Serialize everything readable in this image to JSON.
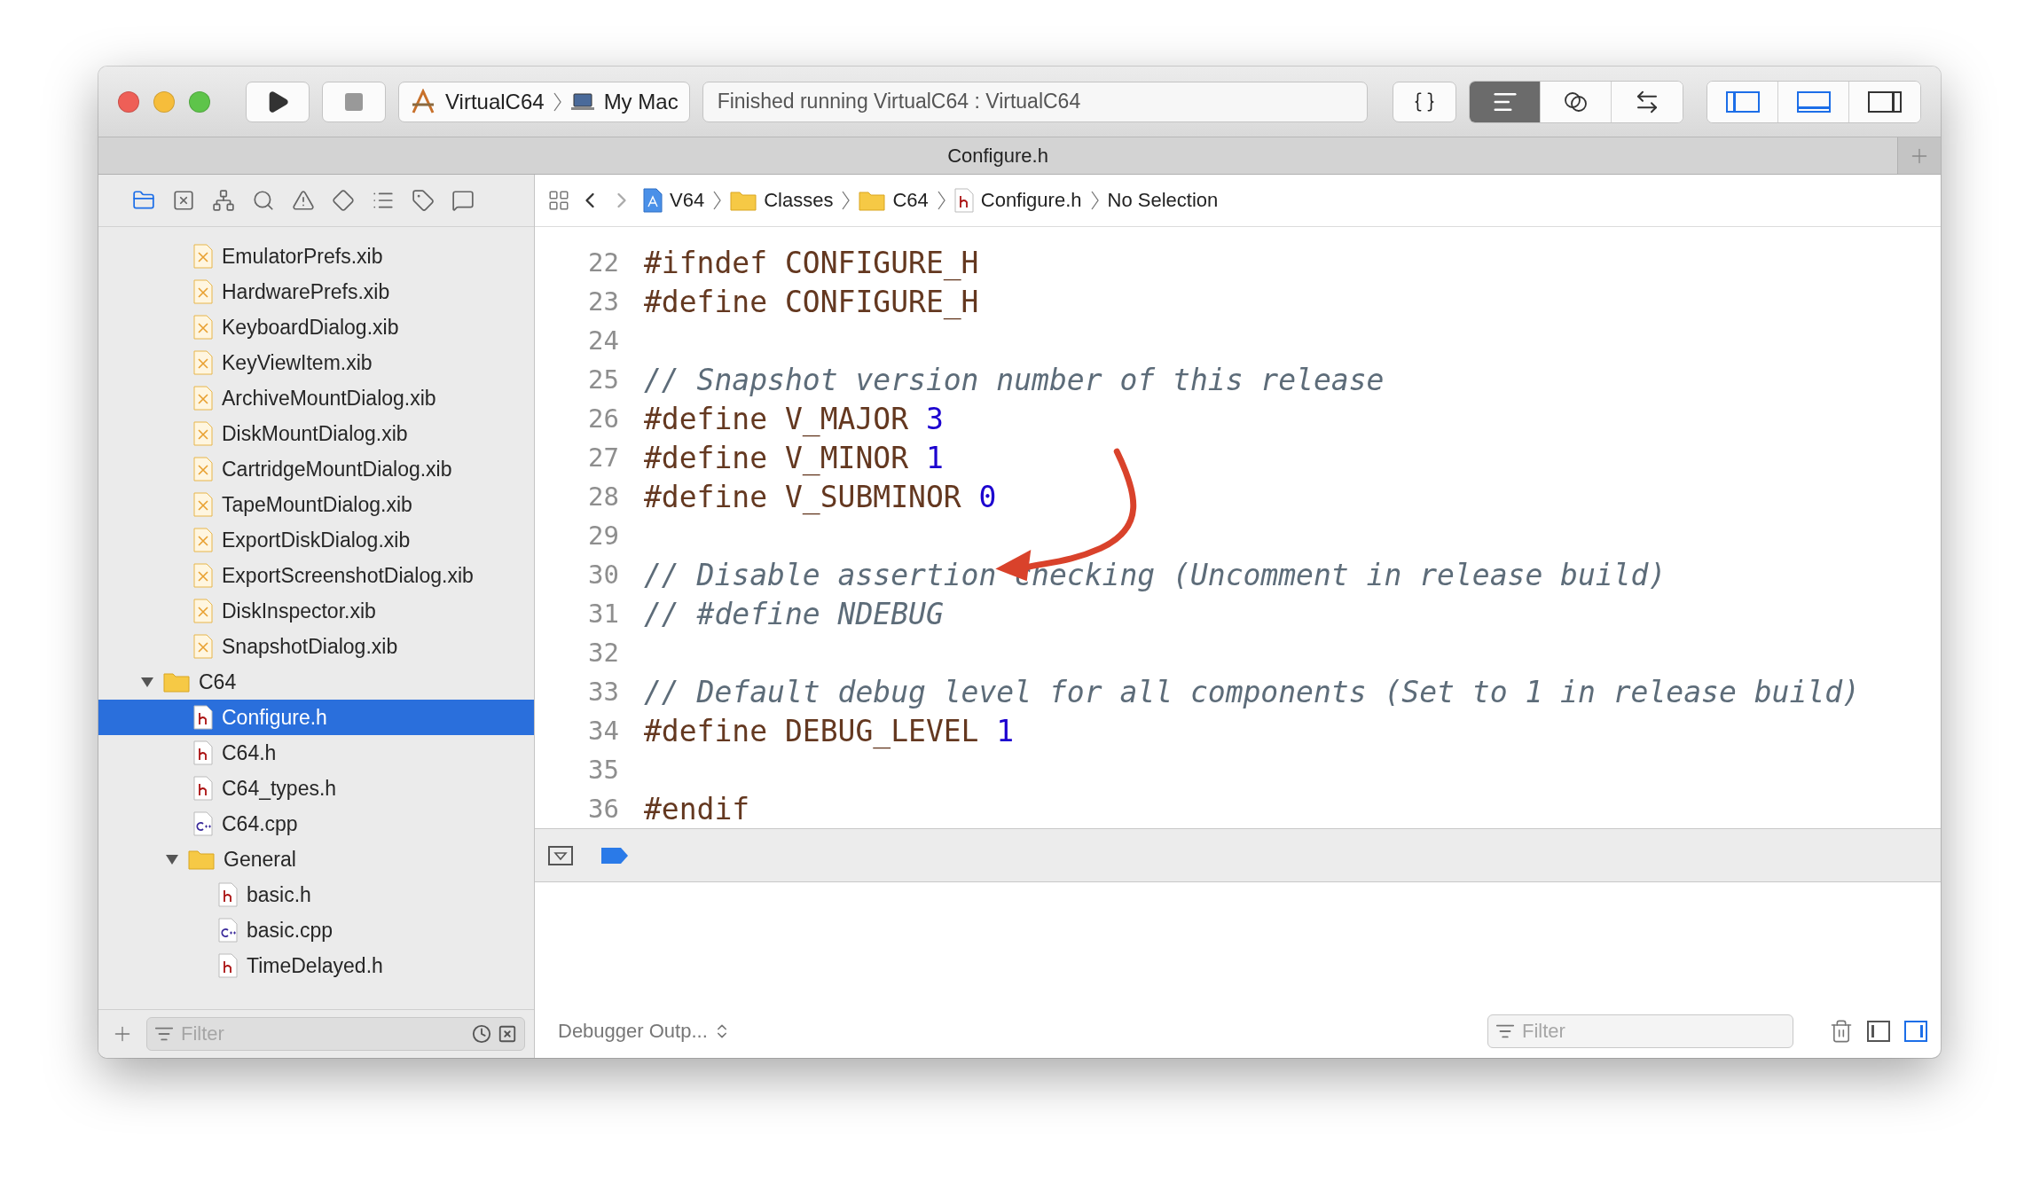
{
  "toolbar": {
    "scheme": {
      "target": "VirtualC64",
      "device": "My Mac"
    },
    "status": "Finished running VirtualC64 : VirtualC64",
    "editor_modes": [
      {
        "kind": "standard",
        "selected": true
      },
      {
        "kind": "assistant",
        "selected": false
      },
      {
        "kind": "version",
        "selected": false
      }
    ],
    "panels": [
      {
        "kind": "navigator",
        "on": true
      },
      {
        "kind": "debug",
        "on": true
      },
      {
        "kind": "inspector",
        "on": false
      }
    ]
  },
  "tab": {
    "title": "Configure.h"
  },
  "navigator": {
    "tabs": [
      {
        "kind": "project",
        "selected": true
      },
      {
        "kind": "source-control",
        "selected": false
      },
      {
        "kind": "symbol",
        "selected": false
      },
      {
        "kind": "find",
        "selected": false
      },
      {
        "kind": "issue",
        "selected": false
      },
      {
        "kind": "test",
        "selected": false
      },
      {
        "kind": "debug",
        "selected": false
      },
      {
        "kind": "breakpoint",
        "selected": false
      },
      {
        "kind": "report",
        "selected": false
      }
    ],
    "tree": [
      {
        "kind": "group",
        "children": [
          {
            "kind": "xib",
            "name": "EmulatorPrefs.xib",
            "selected": false
          },
          {
            "kind": "xib",
            "name": "HardwarePrefs.xib",
            "selected": false
          },
          {
            "kind": "xib",
            "name": "KeyboardDialog.xib",
            "selected": false
          },
          {
            "kind": "xib",
            "name": "KeyViewItem.xib",
            "selected": false
          },
          {
            "kind": "xib",
            "name": "ArchiveMountDialog.xib",
            "selected": false
          },
          {
            "kind": "xib",
            "name": "DiskMountDialog.xib",
            "selected": false
          },
          {
            "kind": "xib",
            "name": "CartridgeMountDialog.xib",
            "selected": false
          },
          {
            "kind": "xib",
            "name": "TapeMountDialog.xib",
            "selected": false
          },
          {
            "kind": "xib",
            "name": "ExportDiskDialog.xib",
            "selected": false
          },
          {
            "kind": "xib",
            "name": "ExportScreenshotDialog.xib",
            "selected": false
          },
          {
            "kind": "xib",
            "name": "DiskInspector.xib",
            "selected": false
          },
          {
            "kind": "xib",
            "name": "SnapshotDialog.xib",
            "selected": false
          }
        ]
      },
      {
        "kind": "folder",
        "name": "C64",
        "expanded": true,
        "selected": false,
        "children": [
          {
            "kind": "h",
            "name": "Configure.h",
            "selected": true
          },
          {
            "kind": "h",
            "name": "C64.h",
            "selected": false
          },
          {
            "kind": "h",
            "name": "C64_types.h",
            "selected": false
          },
          {
            "kind": "cpp",
            "name": "C64.cpp",
            "selected": false
          },
          {
            "kind": "folder",
            "name": "General",
            "expanded": true,
            "selected": false,
            "children": [
              {
                "kind": "h",
                "name": "basic.h",
                "selected": false
              },
              {
                "kind": "cpp",
                "name": "basic.cpp",
                "selected": false
              },
              {
                "kind": "h",
                "name": "TimeDelayed.h",
                "selected": false
              }
            ]
          }
        ]
      }
    ],
    "filter": {
      "placeholder": "Filter"
    }
  },
  "jump_bar": [
    {
      "kind": "project",
      "label": "V64"
    },
    {
      "kind": "folder",
      "label": "Classes"
    },
    {
      "kind": "folder",
      "label": "C64"
    },
    {
      "kind": "h",
      "label": "Configure.h"
    },
    {
      "kind": "none",
      "label": "No Selection"
    }
  ],
  "code": [
    {
      "number": "22",
      "tokens": [
        {
          "kind": "directive",
          "text": "#ifndef CONFIGURE_H"
        }
      ]
    },
    {
      "number": "23",
      "tokens": [
        {
          "kind": "directive",
          "text": "#define CONFIGURE_H"
        }
      ]
    },
    {
      "number": "24"
    },
    {
      "number": "25",
      "tokens": [
        {
          "kind": "comment",
          "text": "// Snapshot version number of this release"
        }
      ]
    },
    {
      "number": "26",
      "tokens": [
        {
          "kind": "directive",
          "text": "#define V_MAJOR "
        },
        {
          "kind": "number",
          "text": "3"
        }
      ]
    },
    {
      "number": "27",
      "tokens": [
        {
          "kind": "directive",
          "text": "#define V_MINOR "
        },
        {
          "kind": "number",
          "text": "1"
        }
      ]
    },
    {
      "number": "28",
      "tokens": [
        {
          "kind": "directive",
          "text": "#define V_SUBMINOR "
        },
        {
          "kind": "number",
          "text": "0"
        }
      ]
    },
    {
      "number": "29"
    },
    {
      "number": "30",
      "tokens": [
        {
          "kind": "comment",
          "text": "// Disable assertion checking (Uncomment in release build)"
        }
      ]
    },
    {
      "number": "31",
      "tokens": [
        {
          "kind": "comment",
          "text": "// #define NDEBUG"
        }
      ]
    },
    {
      "number": "32"
    },
    {
      "number": "33",
      "tokens": [
        {
          "kind": "comment",
          "text": "// Default debug level for all components (Set to 1 in release build)"
        }
      ]
    },
    {
      "number": "34",
      "tokens": [
        {
          "kind": "directive",
          "text": "#define DEBUG_LEVEL "
        },
        {
          "kind": "number",
          "text": "1"
        }
      ]
    },
    {
      "number": "35"
    },
    {
      "number": "36",
      "tokens": [
        {
          "kind": "directive",
          "text": "#endif"
        }
      ]
    }
  ],
  "debug_bar": {
    "breakpoints_active": true
  },
  "console": {
    "output_mode": "Debugger Outp...",
    "filter": {
      "placeholder": "Filter"
    },
    "views": [
      {
        "kind": "variables",
        "on": false
      },
      {
        "kind": "console",
        "on": true
      }
    ]
  }
}
